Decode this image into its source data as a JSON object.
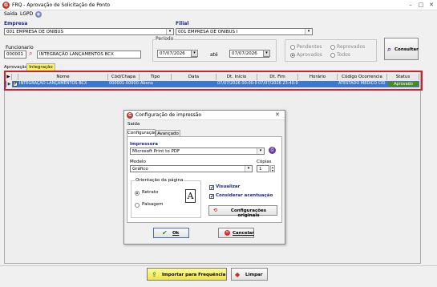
{
  "window": {
    "title": "FRQ - Aprovação de Solicitação de Ponto",
    "menu": [
      "Saida",
      "LGPD"
    ]
  },
  "filters": {
    "empresa_label": "Empresa",
    "empresa_value": "001 EMPRESA DE ONIBUS",
    "filial_label": "Filial",
    "filial_value": "001 EMPRESA DE ONIBUS I",
    "funcionario_label": "Funcionario",
    "funcionario_code": "000001",
    "funcionario_name": "INTEGRAÇÃO LANÇAMENTOS BCX",
    "periodo_label": "Período",
    "date_from": "07/07/2026",
    "ate_label": "até",
    "date_to": "07/07/2026",
    "status_options": [
      {
        "label": "Pendentes",
        "selected": false
      },
      {
        "label": "Reprovados",
        "selected": false
      },
      {
        "label": "Aprovados",
        "selected": true
      },
      {
        "label": "Todos",
        "selected": false
      }
    ],
    "consultar_label": "Consultar"
  },
  "tabs": {
    "prefix": "Aprovação",
    "active": "Integração"
  },
  "grid": {
    "columns": [
      "Nome",
      "Cód/Chapa",
      "Tipo Marcação",
      "Data",
      "Dt. Início",
      "Dt. Fim",
      "Horário Alteração",
      "Código Ocorrencia",
      "Status"
    ],
    "row": {
      "nome": "INTEGRAÇÃO LANÇAMENTOS BCX",
      "cod": "000001-000001",
      "tipo": "Abono",
      "data": "",
      "inicio": "07/07/2026 00:00:00",
      "fim": "07/07/2026 23:40:00",
      "horario": "",
      "ocorrencia": "ATESTADO MEDICO CID",
      "status": "Aprovado"
    }
  },
  "dialog": {
    "title": "Configuração de impressão",
    "menu": "Saida",
    "tabs": [
      "Configuração",
      "Avançado"
    ],
    "impressora_label": "Impressora",
    "impressora_value": "Microsoft Print to PDF",
    "modelo_label": "Modelo",
    "modelo_value": "Gráfico",
    "copias_label": "Cópias",
    "copias_value": "1",
    "orientacao_label": "Orientação da página",
    "retrato_label": "Retrato",
    "paisagem_label": "Paisagem",
    "page_glyph": "A",
    "visualizar_label": "Visualizar",
    "acentuacao_label": "Considerar acentuação",
    "config_originais_label": "Configurações originais",
    "ok_label": "Ok",
    "cancelar_label": "Cancelar"
  },
  "footer": {
    "importar_label": "Importar para Frequência",
    "limpar_label": "Limpar"
  },
  "colors": {
    "selection_row": "#3a78d4",
    "highlight_border": "#d0202c",
    "status_green": "#4a8a2a",
    "label_blue": "#1a2a8a",
    "brand_red": "#c0392b"
  }
}
